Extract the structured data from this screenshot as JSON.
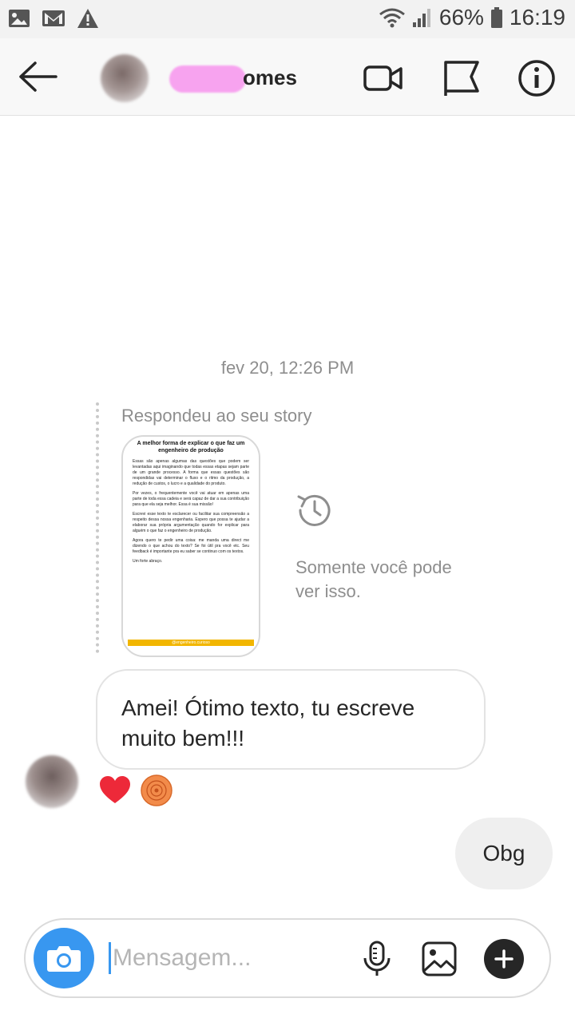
{
  "status_bar": {
    "battery": "66%",
    "time": "16:19"
  },
  "header": {
    "name_suffix": "omes"
  },
  "chat": {
    "timestamp": "fev 20, 12:26 PM",
    "reply_label": "Respondeu ao seu story",
    "story": {
      "title": "A melhor forma de explicar o que faz um engenheiro de produção",
      "paragraphs": [
        "Essas são apenas algumas das questões que podem ser levantadas aqui imaginando que todas essas etapas sejam parte de um grande processo. A forma que essas questões são respondidas vai determinar o fluxo e o ritmo da produção, a redução de custos, o lucro e a qualidade do produto.",
        "Por vezes, o frequentemente você vai atuar em apenas uma parte de toda essa cadeia e será capaz de dar a sua contribuição para que ela seja melhor. Essa é sua missão!",
        "Escrevi esse texto te esclarecer ou facilitar sua compreensão a respeito dessa nossa engenharia. Espero que possa te ajudar a elaborar sua própria argumentação quando for explicar para alguém o que faz o engenheiro de produção.",
        "Agora quero te pedir uma coisa: me manda uma direct me dizendo o que achou do texto? Se foi útil pra você etc. Seu feedback é importante pra eu saber se continuo com os textos.",
        "Um forte abraço."
      ],
      "footer": "@engenheiro.curioso"
    },
    "only_you_text": "Somente você pode ver isso.",
    "incoming_message": "Amei! Ótimo texto, tu escreve muito bem!!!",
    "outgoing_message": "Obg"
  },
  "composer": {
    "placeholder": "Mensagem..."
  },
  "icons": {
    "back": "arrow-left-icon",
    "video": "video-call-icon",
    "flag": "flag-icon",
    "info": "info-icon",
    "history": "history-icon",
    "camera": "camera-icon",
    "mic": "microphone-icon",
    "gallery": "image-icon",
    "plus": "plus-icon"
  },
  "colors": {
    "accent": "#3897f0",
    "heart": "#ed4956",
    "name_mask": "#f7a3ef"
  }
}
